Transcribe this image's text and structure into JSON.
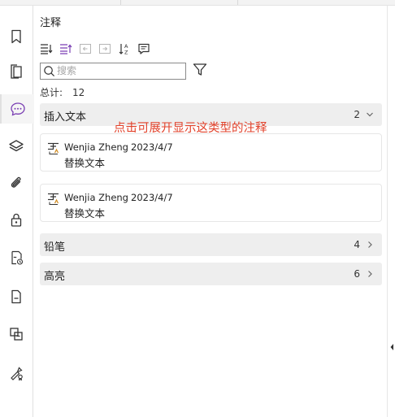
{
  "panel": {
    "title": "注释",
    "search_placeholder": "搜索",
    "total_label": "总计:",
    "total_count": "12",
    "hint": "点击可展开显示这类型的注释"
  },
  "groups": [
    {
      "name": "插入文本",
      "count": "2",
      "expanded": true
    },
    {
      "name": "铅笔",
      "count": "4",
      "expanded": false
    },
    {
      "name": "高亮",
      "count": "6",
      "expanded": false
    }
  ],
  "cards": [
    {
      "author": "Wenjia Zheng",
      "date": "2023/4/7",
      "text": "替换文本"
    },
    {
      "author": "Wenjia Zheng",
      "date": "2023/4/7",
      "text": "替换文本"
    }
  ],
  "colors": {
    "accent": "#7a3fb3",
    "hint": "#e2422b",
    "group_bg": "#eeeeee"
  },
  "icons": {
    "rail": [
      "bookmark-icon",
      "pages-icon",
      "comments-icon",
      "layers-icon",
      "attachment-icon",
      "lock-icon",
      "signature-verify-icon",
      "document-icon",
      "compare-icon",
      "certificate-icon"
    ],
    "toolbar": [
      "expand-all-icon",
      "collapse-all-icon",
      "previous-icon",
      "next-icon",
      "sort-icon",
      "comment-summary-icon"
    ]
  }
}
